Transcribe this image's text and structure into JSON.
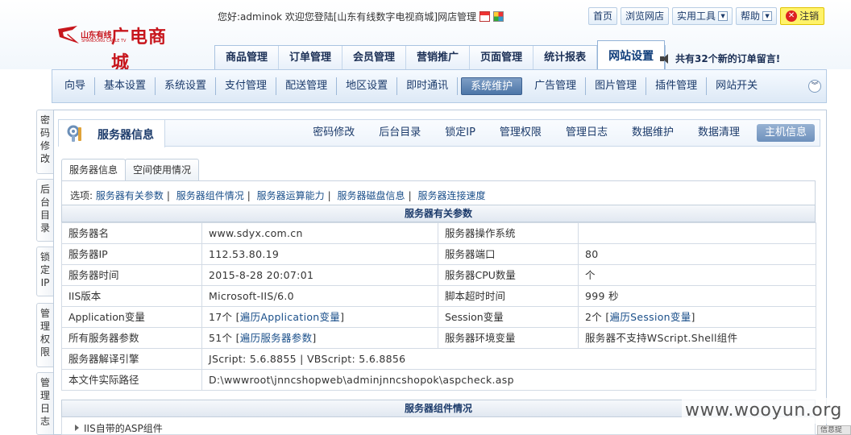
{
  "brand": {
    "logo_small": "山东有线",
    "logo_small_en": "SHANDONG CABLE TV",
    "logo_big": "广电商城"
  },
  "header": {
    "welcome": "您好:adminok 欢迎您登陆[山东有线数字电视商城]网店管理",
    "links": {
      "home": "首页",
      "browse": "浏览网店",
      "tools": "实用工具",
      "help": "帮助",
      "logout": "注销"
    }
  },
  "main_tabs": [
    "商品管理",
    "订单管理",
    "会员管理",
    "营销推广",
    "页面管理",
    "统计报表",
    "网站设置"
  ],
  "notice": "共有32个新的订单留言!",
  "sub_nav": [
    "向导",
    "基本设置",
    "系统设置",
    "支付管理",
    "配送管理",
    "地区设置",
    "即时通讯",
    "系统维护",
    "广告管理",
    "图片管理",
    "插件管理",
    "网站开关"
  ],
  "side_tabs": [
    "密码修改",
    "后台目录",
    "锁定IP",
    "管理权限",
    "管理日志"
  ],
  "section": {
    "title": "服务器信息",
    "links": [
      "密码修改",
      "后台目录",
      "锁定IP",
      "管理权限",
      "管理日志",
      "数据维护",
      "数据清理",
      "主机信息"
    ]
  },
  "inner_tabs": [
    "服务器信息",
    "空间使用情况"
  ],
  "options": {
    "label": "选项:",
    "items": [
      "服务器有关参数",
      "服务器组件情况",
      "服务器运算能力",
      "服务器磁盘信息",
      "服务器连接速度"
    ]
  },
  "server_params": {
    "title": "服务器有关参数",
    "rows": [
      {
        "k1": "服务器名",
        "v1": "www.sdyx.com.cn",
        "k2": "服务器操作系统",
        "v2": ""
      },
      {
        "k1": "服务器IP",
        "v1": "112.53.80.19",
        "k2": "服务器端口",
        "v2": "80"
      },
      {
        "k1": "服务器时间",
        "v1": "2015-8-28 20:07:01",
        "k2": "服务器CPU数量",
        "v2": "个"
      },
      {
        "k1": "IIS版本",
        "v1": "Microsoft-IIS/6.0",
        "k2": "脚本超时时间",
        "v2": "999 秒"
      },
      {
        "k1": "Application变量",
        "v1_pre": "17个 [",
        "v1_link": "遍历Application变量",
        "v1_post": "]",
        "k2": "Session变量",
        "v2_pre": "2个 [",
        "v2_link": "遍历Session变量",
        "v2_post": "]"
      },
      {
        "k1": "所有服务器参数",
        "v1_pre": "51个 [",
        "v1_link": "遍历服务器参数",
        "v1_post": "]",
        "k2": "服务器环境变量",
        "v2": "服务器不支持WScript.Shell组件"
      },
      {
        "k1": "服务器解译引擎",
        "v1": "JScript: 5.6.8855 | VBScript: 5.6.8856"
      },
      {
        "k1": "本文件实际路径",
        "v1": "D:\\wwwroot\\jnncshopweb\\adminjnncshopok\\aspcheck.asp"
      }
    ]
  },
  "components": {
    "title": "服务器组件情况",
    "row": "IIS自带的ASP组件"
  },
  "watermark": "www.wooyun.org",
  "corner_tab": "信息提"
}
